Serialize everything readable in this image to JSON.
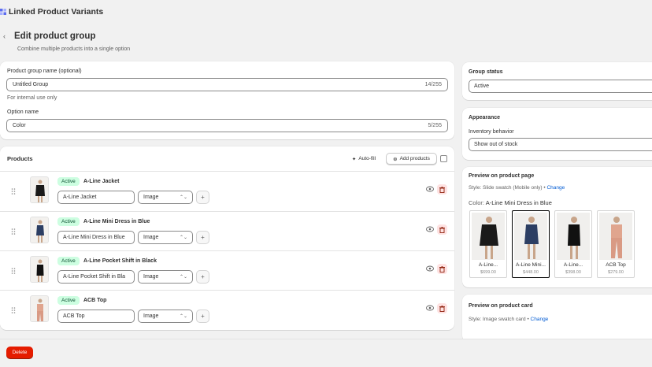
{
  "app": {
    "title": "Linked Product Variants"
  },
  "header": {
    "title": "Edit product group",
    "subtitle": "Combine multiple products into a single option"
  },
  "group_form": {
    "name_label": "Product group name (optional)",
    "name_value": "Untitled Group",
    "name_counter": "14/255",
    "name_help": "For internal use only",
    "option_label": "Option name",
    "option_value": "Color",
    "option_counter": "5/255"
  },
  "products": {
    "title": "Products",
    "autofill_label": "Auto-fill",
    "add_label": "Add products",
    "rows": [
      {
        "status": "Active",
        "name": "A-Line Jacket",
        "option_value": "A-Line Jacket",
        "type": "Image"
      },
      {
        "status": "Active",
        "name": "A-Line Mini Dress in Blue",
        "option_value": "A-Line Mini Dress in Blue",
        "type": "Image"
      },
      {
        "status": "Active",
        "name": "A-Line Pocket Shift in Black",
        "option_value": "A-Line Pocket Shift in Bla",
        "type": "Image"
      },
      {
        "status": "Active",
        "name": "ACB Top",
        "option_value": "ACB Top",
        "type": "Image"
      }
    ]
  },
  "group_status": {
    "title": "Group status",
    "value": "Active"
  },
  "appearance": {
    "title": "Appearance",
    "inventory_label": "Inventory behavior",
    "inventory_value": "Show out of stock"
  },
  "preview_page": {
    "title": "Preview on product page",
    "style_text": "Style: Slide swatch (Mobile only)",
    "change_label": "Change",
    "color_label": "Color:",
    "color_value": "A-Line Mini Dress in Blue",
    "swatches": [
      {
        "name": "A-Line...",
        "price": "$699.00"
      },
      {
        "name": "A-Line Mini...",
        "price": "$448.00"
      },
      {
        "name": "A-Line...",
        "price": "$398.00"
      },
      {
        "name": "ACB Top",
        "price": "$279.00"
      }
    ]
  },
  "preview_card": {
    "title": "Preview on product card",
    "style_text": "Style: Image swatch card",
    "change_label": "Change"
  },
  "footer": {
    "delete_label": "Delete"
  },
  "colors": {
    "accent_link": "#005bd3",
    "badge_bg": "#cdfee1",
    "delete_bg": "#e51c00"
  }
}
